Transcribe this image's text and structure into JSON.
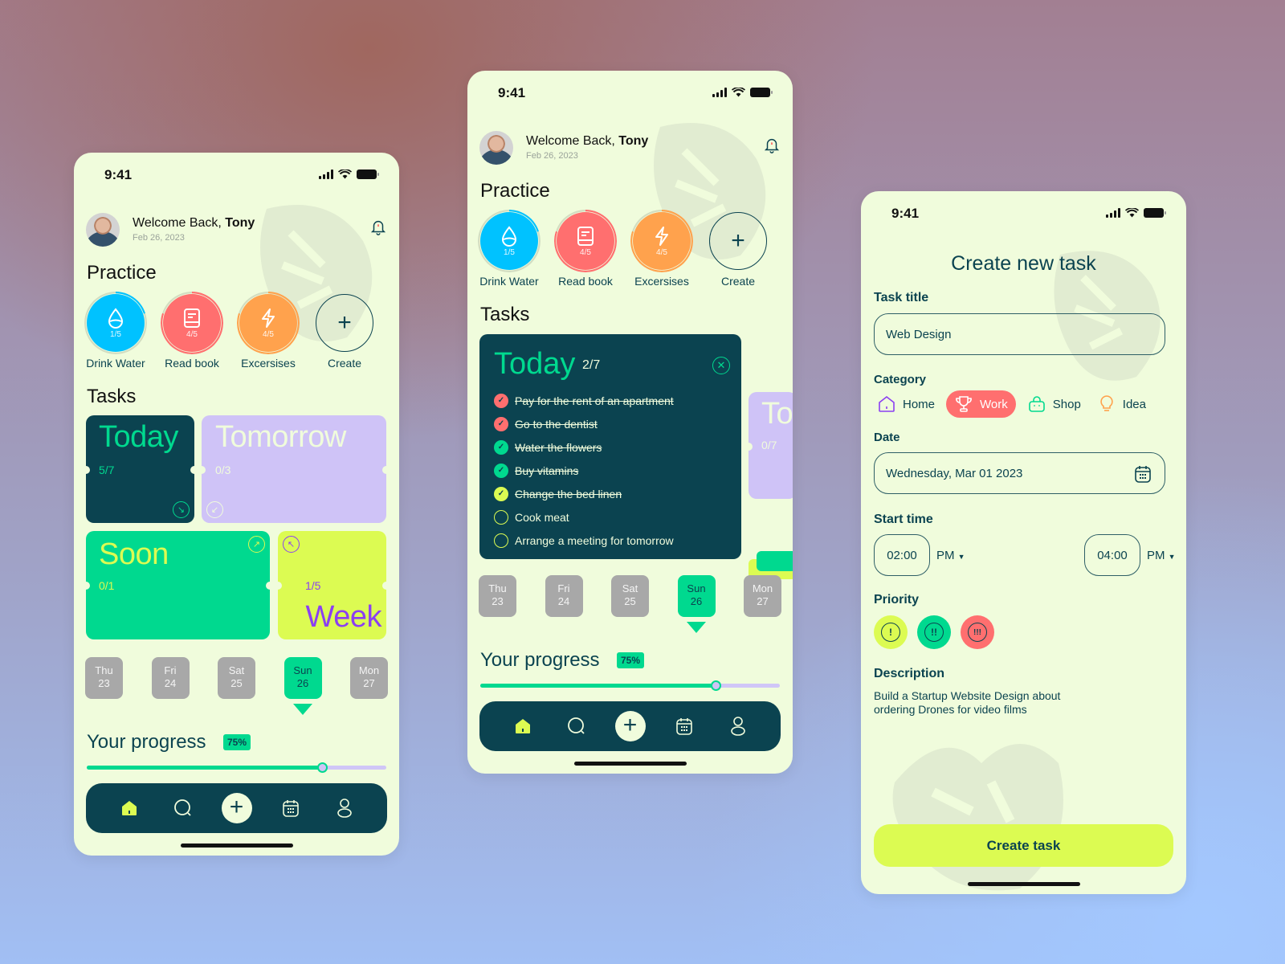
{
  "colors": {
    "background_card": "#f0fcdc",
    "dark_teal": "#0b4350",
    "green": "#00d98f",
    "lime": "#dcfb52",
    "lavender": "#cfc3f7",
    "coral": "#ff6f6f",
    "sky": "#00c2ff",
    "orange": "#ffa24d",
    "purple": "#8b3ff2",
    "gray_day": "#a8a8a8"
  },
  "status_bar": {
    "time": "9:41"
  },
  "header": {
    "welcome_prefix": "Welcome Back, ",
    "user_name": "Tony",
    "date": "Feb 26, 2023"
  },
  "practice": {
    "title": "Practice",
    "items": [
      {
        "label": "Drink Water",
        "count": "1/5",
        "icon": "water-drop-icon",
        "progress": 0.2,
        "color": "#00c2ff"
      },
      {
        "label": "Read book",
        "count": "4/5",
        "icon": "book-icon",
        "progress": 0.8,
        "color": "#ff6f6f"
      },
      {
        "label": "Excersises",
        "count": "4/5",
        "icon": "lightning-icon",
        "progress": 0.8,
        "color": "#ffa24d"
      },
      {
        "label": "Create",
        "icon": "plus-icon"
      }
    ]
  },
  "tasks": {
    "title": "Tasks",
    "cards": [
      {
        "title": "Today",
        "count": "5/7"
      },
      {
        "title": "Tomorrow",
        "count": "0/3"
      },
      {
        "title": "Soon",
        "count": "0/1"
      },
      {
        "title": "Week",
        "count": "1/5"
      }
    ]
  },
  "today_expanded": {
    "title": "Today",
    "count": "2/7",
    "peek_title": "To",
    "peek_count": "0/7",
    "items": [
      {
        "text": "Pay for the rent of an apartment",
        "done": true,
        "color": "#ff6f6f"
      },
      {
        "text": "Go to the dentist",
        "done": true,
        "color": "#ff6f6f"
      },
      {
        "text": "Water the flowers",
        "done": true,
        "color": "#00d98f"
      },
      {
        "text": "Buy vitamins",
        "done": true,
        "color": "#00d98f"
      },
      {
        "text": "Change the bed linen",
        "done": true,
        "color": "#dcfb52"
      },
      {
        "text": "Cook meat",
        "done": false,
        "color": "#dcfb52"
      },
      {
        "text": "Arrange a meeting for tomorrow",
        "done": false,
        "color": "#dcfb52"
      }
    ]
  },
  "days": [
    {
      "name": "Thu",
      "num": "23",
      "active": false
    },
    {
      "name": "Fri",
      "num": "24",
      "active": false
    },
    {
      "name": "Sat",
      "num": "25",
      "active": false
    },
    {
      "name": "Sun",
      "num": "26",
      "active": true
    },
    {
      "name": "Mon",
      "num": "27",
      "active": false
    }
  ],
  "progress": {
    "title": "Your progress",
    "badge": "75%",
    "value": 0.785
  },
  "nav": {
    "items": [
      "home-icon",
      "search-icon",
      "plus-icon",
      "calendar-icon",
      "profile-icon"
    ],
    "plus": "+"
  },
  "create_form": {
    "title": "Create new task",
    "task_title_label": "Task title",
    "task_title_value": "Web Design",
    "category_label": "Category",
    "categories": [
      {
        "label": "Home",
        "icon": "home-icon",
        "active": false,
        "color": "#8b3ff2"
      },
      {
        "label": "Work",
        "icon": "trophy-icon",
        "active": true,
        "color": "#ffffff"
      },
      {
        "label": "Shop",
        "icon": "shopping-bag-icon",
        "active": false,
        "color": "#00d98f"
      },
      {
        "label": "Idea",
        "icon": "lightbulb-icon",
        "active": false,
        "color": "#ffa24d"
      }
    ],
    "date_label": "Date",
    "date_value": "Wednesday, Mar 01 2023",
    "start_time_label": "Start time",
    "start_time": "02:00",
    "start_ampm": "PM",
    "end_time": "04:00",
    "end_ampm": "PM",
    "priority_label": "Priority",
    "priorities": [
      {
        "level": "low",
        "glyph": "!",
        "color": "#dcfb52"
      },
      {
        "level": "medium",
        "glyph": "!!",
        "color": "#00d98f"
      },
      {
        "level": "high",
        "glyph": "!!!",
        "color": "#ff6f6f"
      }
    ],
    "description_label": "Description",
    "description_value": "Build a Startup Website Design about ordering Drones for video films",
    "submit_label": "Create task"
  }
}
